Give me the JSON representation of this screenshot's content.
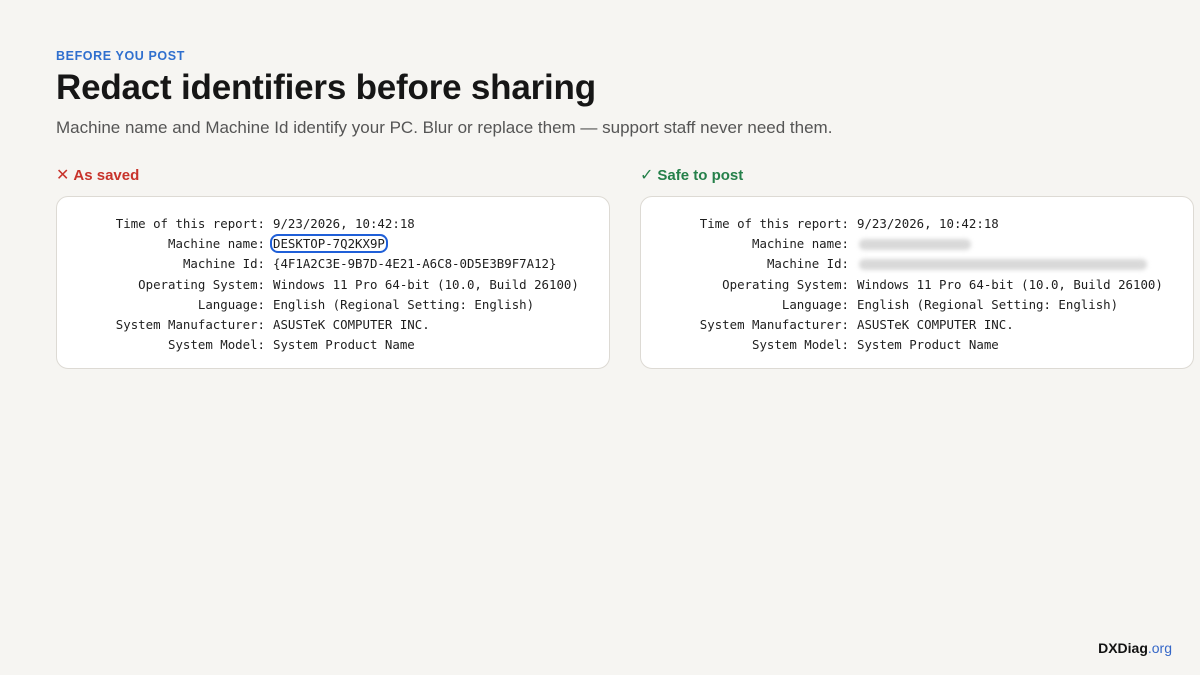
{
  "header": {
    "eyebrow": "BEFORE YOU POST",
    "title": "Redact identifiers before sharing",
    "subtitle": "Machine name and Machine Id identify your PC. Blur or replace them — support staff never need them."
  },
  "panels": {
    "before": {
      "icon": "x-icon",
      "icon_glyph": "✕",
      "label": "As saved",
      "color": "#c8332b",
      "rows": [
        {
          "key": "Time of this report:",
          "value": "9/23/2026, 10:42:18"
        },
        {
          "key": "Machine name:",
          "value": "DESKTOP-7Q2KX9P",
          "highlighted": true
        },
        {
          "key": "Machine Id:",
          "value": "{4F1A2C3E-9B7D-4E21-A6C8-0D5E3B9F7A12}"
        },
        {
          "key": "Operating System:",
          "value": "Windows 11 Pro 64-bit (10.0, Build 26100)"
        },
        {
          "key": "Language:",
          "value": "English (Regional Setting: English)"
        },
        {
          "key": "System Manufacturer:",
          "value": "ASUSTeK COMPUTER INC."
        },
        {
          "key": "System Model:",
          "value": "System Product Name"
        }
      ]
    },
    "after": {
      "icon": "check-icon",
      "icon_glyph": "✓",
      "label": "Safe to post",
      "color": "#25804a",
      "rows": [
        {
          "key": "Time of this report:",
          "value": "9/23/2026, 10:42:18"
        },
        {
          "key": "Machine name:",
          "value": "",
          "blurred": true
        },
        {
          "key": "Machine Id:",
          "value": "",
          "blurred": true
        },
        {
          "key": "Operating System:",
          "value": "Windows 11 Pro 64-bit (10.0, Build 26100)"
        },
        {
          "key": "Language:",
          "value": "English (Regional Setting: English)"
        },
        {
          "key": "System Manufacturer:",
          "value": "ASUSTeK COMPUTER INC."
        },
        {
          "key": "System Model:",
          "value": "System Product Name"
        }
      ]
    }
  },
  "brand": {
    "name": "DXDiag",
    "tld": ".org"
  }
}
